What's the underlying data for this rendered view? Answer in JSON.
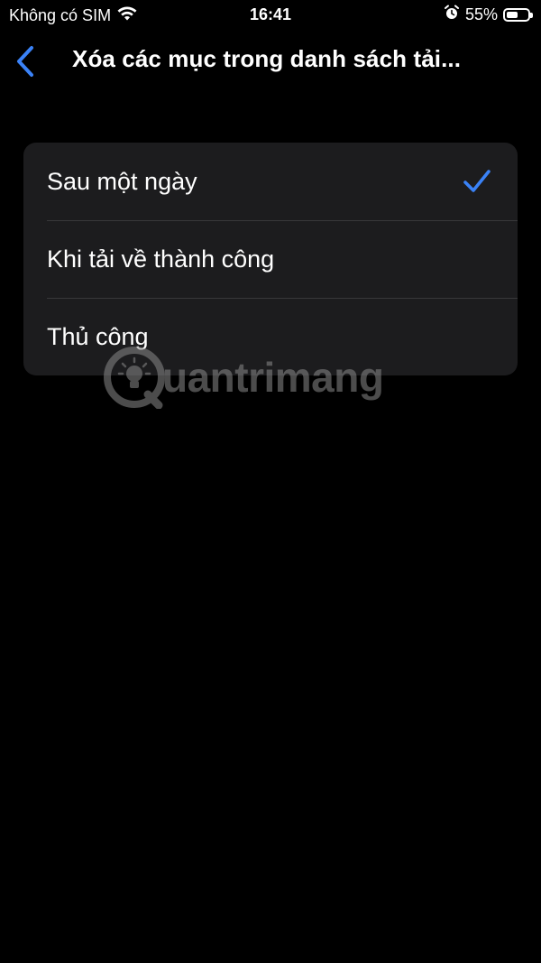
{
  "status_bar": {
    "carrier": "Không có SIM",
    "time": "16:41",
    "battery_percent": "55%",
    "battery_level": 0.55,
    "icons": [
      "wifi-icon",
      "alarm-icon",
      "battery-icon"
    ]
  },
  "nav": {
    "title": "Xóa các mục trong danh sách tải...",
    "back_icon": "chevron-left-icon"
  },
  "options": {
    "items": [
      {
        "label": "Sau một ngày",
        "selected": true
      },
      {
        "label": "Khi tải về thành công",
        "selected": false
      },
      {
        "label": "Thủ công",
        "selected": false
      }
    ]
  },
  "watermark": {
    "text": "uantrimang"
  },
  "colors": {
    "background": "#000000",
    "cell": "#1c1c1e",
    "separator": "#38383a",
    "accent": "#3a82f7",
    "text": "#ffffff"
  }
}
